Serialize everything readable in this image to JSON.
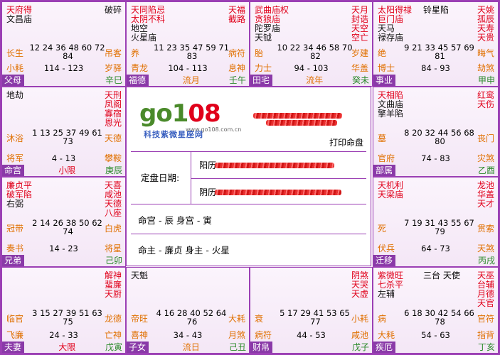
{
  "palaces": [
    {
      "id": "si",
      "row": 0,
      "col": 0,
      "stars_left": [
        {
          "t": "天府得",
          "c": "red"
        },
        {
          "t": "文昌庙",
          "c": "blk"
        }
      ],
      "stars_right": [
        {
          "t": "破碎",
          "c": "blk"
        }
      ],
      "stage_left": "长生",
      "ages1": "12 24 36 48 60 72",
      "ages2": "84",
      "stage_right": "吊客",
      "bl": "小耗",
      "range": "114 - 123",
      "br": "岁驿",
      "name": "父母",
      "liu": "",
      "gz_mark": "",
      "gz_stem": "辛巳"
    },
    {
      "id": "wu",
      "row": 0,
      "col": 1,
      "stars_left": [
        {
          "t": "天同陷忌",
          "c": "red"
        },
        {
          "t": "太阴不科",
          "c": "red"
        },
        {
          "t": "地空",
          "c": "blk"
        },
        {
          "t": "火星庙",
          "c": "blk"
        }
      ],
      "stars_right": [
        {
          "t": "天福",
          "c": "red"
        },
        {
          "t": "截路",
          "c": "red"
        }
      ],
      "stage_left": "养",
      "ages1": "11 23 35 47 59 71",
      "ages2": "83",
      "stage_right": "病符",
      "bl": "青龙",
      "range": "104 - 113",
      "br": "息神",
      "name": "福德",
      "liu": "流月",
      "gz_mark": "",
      "gz_stem": "壬午"
    },
    {
      "id": "wei",
      "row": 0,
      "col": 2,
      "stars_left": [
        {
          "t": "武曲庙权",
          "c": "red"
        },
        {
          "t": "贪狼庙",
          "c": "red"
        },
        {
          "t": "陀罗庙",
          "c": "blk"
        },
        {
          "t": "天钺",
          "c": "blk"
        }
      ],
      "stars_right": [
        {
          "t": "天月",
          "c": "red"
        },
        {
          "t": "封诰",
          "c": "red"
        },
        {
          "t": "天空",
          "c": "red"
        },
        {
          "t": "空亡",
          "c": "red"
        }
      ],
      "stage_left": "胎",
      "ages1": "10 22 34 46 58 70",
      "ages2": "82",
      "stage_right": "岁建",
      "bl": "力士",
      "range": "94 - 103",
      "br": "华盖",
      "name": "田宅",
      "liu": "流年",
      "gz_mark": "",
      "gz_stem": "癸未"
    },
    {
      "id": "shen",
      "row": 0,
      "col": 3,
      "stars_left": [
        {
          "t": "太阳得禄",
          "c": "red"
        },
        {
          "t": "巨门庙",
          "c": "red"
        },
        {
          "t": "天马",
          "c": "blk"
        },
        {
          "t": "禄存庙",
          "c": "blk"
        }
      ],
      "stars_mid": "铃星陷",
      "stars_right": [
        {
          "t": "天姚",
          "c": "red"
        },
        {
          "t": "孤辰",
          "c": "red"
        },
        {
          "t": "天寿",
          "c": "red"
        },
        {
          "t": "天贵",
          "c": "red"
        }
      ],
      "stage_left": "绝",
      "ages1": "9 21 33 45 57 69",
      "ages2": "81",
      "stage_right": "晦气",
      "bl": "博士",
      "range": "84 - 93",
      "br": "劫煞",
      "name": "事业",
      "liu": "",
      "gz_mark": "",
      "gz_stem": "甲申"
    },
    {
      "id": "chen",
      "row": 1,
      "col": 0,
      "stars_left": [
        {
          "t": "地劫",
          "c": "blk"
        }
      ],
      "stars_right": [
        {
          "t": "天刑",
          "c": "red"
        },
        {
          "t": "凤阁",
          "c": "red"
        },
        {
          "t": "寡宿",
          "c": "red"
        },
        {
          "t": "恩光",
          "c": "red"
        }
      ],
      "stage_left": "沐浴",
      "ages1": "1 13 25 37 49 61",
      "ages2": "73",
      "stage_right": "天德",
      "bl": "将军",
      "range": "4 - 13",
      "br": "攀鞍",
      "name": "命宫",
      "liu": "小限",
      "gz_mark": "",
      "gz_stem": "庚辰"
    },
    {
      "id": "you",
      "row": 1,
      "col": 3,
      "stars_left": [
        {
          "t": "天相陷",
          "c": "red"
        },
        {
          "t": "文曲庙",
          "c": "blk"
        },
        {
          "t": "擎羊陷",
          "c": "blk"
        }
      ],
      "stars_right": [
        {
          "t": "红鸾",
          "c": "red"
        },
        {
          "t": "天伤",
          "c": "red"
        }
      ],
      "stage_left": "墓",
      "ages1": "8 20 32 44 56 68",
      "ages2": "80",
      "stage_right": "丧门",
      "bl": "官府",
      "range": "74 - 83",
      "br": "灾煞",
      "name": "部属",
      "liu": "",
      "gz_mark": "",
      "gz_stem": "乙酉"
    },
    {
      "id": "mao",
      "row": 2,
      "col": 0,
      "stars_left": [
        {
          "t": "廉贞平",
          "c": "red"
        },
        {
          "t": "破军陷",
          "c": "red"
        },
        {
          "t": "右弼",
          "c": "blk"
        }
      ],
      "stars_right": [
        {
          "t": "天喜",
          "c": "red"
        },
        {
          "t": "咸池",
          "c": "red"
        },
        {
          "t": "天德",
          "c": "red"
        },
        {
          "t": "八座",
          "c": "red"
        }
      ],
      "stage_left": "冠带",
      "ages1": "2 14 26 38 50 62",
      "ages2": "74",
      "stage_right": "白虎",
      "bl": "奏书",
      "range": "14 - 23",
      "br": "将星",
      "name": "兄弟",
      "liu": "",
      "gz_mark": "",
      "gz_stem": "己卯"
    },
    {
      "id": "xu",
      "row": 2,
      "col": 3,
      "stars_left": [
        {
          "t": "天机利",
          "c": "red"
        },
        {
          "t": "天梁庙",
          "c": "red"
        }
      ],
      "stars_right": [
        {
          "t": "龙池",
          "c": "red"
        },
        {
          "t": "华盖",
          "c": "red"
        },
        {
          "t": "天才",
          "c": "red"
        }
      ],
      "stage_left": "死",
      "ages1": "7 19 31 43 55 67",
      "ages2": "79",
      "stage_right": "贯索",
      "bl": "伏兵",
      "range": "64 - 73",
      "br": "天煞",
      "name": "迁移",
      "liu": "",
      "gz_mark": "",
      "gz_stem": "丙戌"
    },
    {
      "id": "yin",
      "row": 3,
      "col": 0,
      "stars_left": [],
      "stars_right": [
        {
          "t": "解神",
          "c": "red"
        },
        {
          "t": "蜚廉",
          "c": "red"
        },
        {
          "t": "天厨",
          "c": "red"
        }
      ],
      "stage_left": "临官",
      "ages1": "3 15 27 39 51 63",
      "ages2": "75",
      "stage_right": "龙德",
      "bl": "飞廉",
      "range": "24 - 33",
      "br": "亡神",
      "name": "夫妻",
      "liu": "大限",
      "gz_mark": "",
      "gz_stem": "戊寅"
    },
    {
      "id": "chou",
      "row": 3,
      "col": 1,
      "stars_left": [
        {
          "t": "天魁",
          "c": "blk"
        }
      ],
      "stars_right": [],
      "stage_left": "帝旺",
      "ages1": "4 16 28 40 52 64",
      "ages2": "76",
      "stage_right": "大耗",
      "bl": "喜神",
      "range": "34 - 43",
      "br": "月煞",
      "name": "子女",
      "liu": "流日",
      "gz_mark": "",
      "gz_stem": "己丑"
    },
    {
      "id": "zi",
      "row": 3,
      "col": 2,
      "stars_left": [],
      "stars_right": [
        {
          "t": "阴煞",
          "c": "red"
        },
        {
          "t": "天哭",
          "c": "red"
        },
        {
          "t": "天虚",
          "c": "red"
        }
      ],
      "stage_left": "衰",
      "ages1": "5 17 29 41 53 65",
      "ages2": "77",
      "stage_right": "小耗",
      "bl": "病符",
      "range": "44 - 53",
      "br": "咸池",
      "name": "财帛",
      "liu": "",
      "gz_mark": "",
      "gz_stem": "戊子"
    },
    {
      "id": "hai",
      "row": 3,
      "col": 3,
      "stars_left": [
        {
          "t": "紫微旺",
          "c": "red"
        },
        {
          "t": "七杀平",
          "c": "red"
        },
        {
          "t": "左辅",
          "c": "blk"
        }
      ],
      "stars_mid": "三台 天使",
      "stars_right": [
        {
          "t": "天巫",
          "c": "red"
        },
        {
          "t": "台辅",
          "c": "red"
        },
        {
          "t": "月德",
          "c": "red"
        },
        {
          "t": "天官",
          "c": "red"
        }
      ],
      "stage_left": "病",
      "ages1": "6 18 30 42 54 66",
      "ages2": "78",
      "stage_right": "官符",
      "bl": "大耗",
      "range": "54 - 63",
      "br": "指背",
      "name": "疾厄",
      "liu": "",
      "gz_mark": "",
      "gz_stem": "丁亥"
    }
  ],
  "center": {
    "logo_text_a": "go1",
    "logo_text_b": "08",
    "logo_url": "www.go108.com.cn",
    "logo_slogan": "科技紫微星座网",
    "print_label": "打印命盘",
    "date_label": "定盘日期:",
    "yang_label": "阳历",
    "yin_label": "阴历",
    "ming_line": "命宫 - 辰  身宫 - 寅",
    "zhu_line": "命主 - 廉贞  身主 - 火星"
  }
}
